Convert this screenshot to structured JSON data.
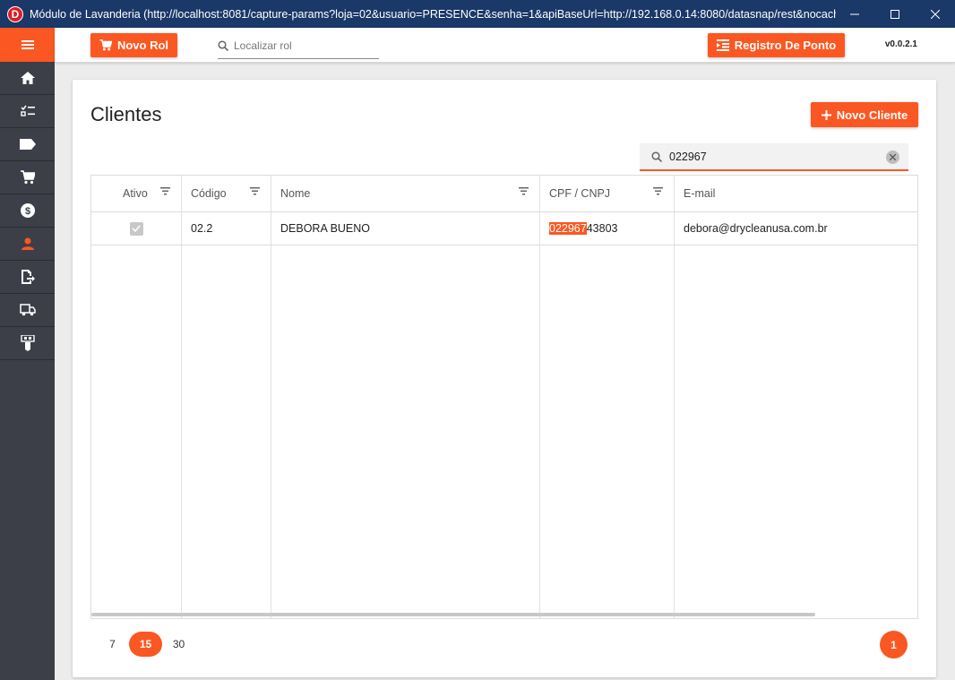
{
  "window": {
    "app_icon_letter": "D",
    "title": "Módulo de Lavanderia (http://localhost:8081/capture-params?loja=02&usuario=PRESENCE&senha=1&apiBaseUrl=http://192.168.0.14:8080/datasnap/rest&nocache=2..."
  },
  "sidebar": {
    "items": [
      {
        "icon": "menu-icon"
      },
      {
        "icon": "home-icon"
      },
      {
        "icon": "checklist-icon"
      },
      {
        "icon": "label-icon"
      },
      {
        "icon": "cart-icon"
      },
      {
        "icon": "money-icon"
      },
      {
        "icon": "person-icon",
        "active": true
      },
      {
        "icon": "export-document-icon"
      },
      {
        "icon": "delivery-truck-icon"
      },
      {
        "icon": "cash-register-icon"
      }
    ]
  },
  "topbar": {
    "novo_rol": "Novo Rol",
    "search_placeholder": "Localizar rol",
    "registro_ponto": "Registro De Ponto",
    "version": "v0.0.2.1"
  },
  "page": {
    "title": "Clientes",
    "novo_cliente": "Novo Cliente",
    "filter_value": "022967"
  },
  "table": {
    "columns": [
      "Ativo",
      "Código",
      "Nome",
      "CPF / CNPJ",
      "E-mail"
    ],
    "rows": [
      {
        "ativo": true,
        "codigo": "02.2",
        "nome": "DEBORA BUENO",
        "cpf_match": "022967",
        "cpf_rest": "43803",
        "email": "debora@drycleanusa.com.br"
      }
    ]
  },
  "pager": {
    "sizes": [
      "7",
      "15",
      "30"
    ],
    "selected_size": "15",
    "current_page": "1"
  },
  "colors": {
    "accent": "#fb5722",
    "titlebar": "#1a3868",
    "sidebar": "#3c3f48"
  }
}
